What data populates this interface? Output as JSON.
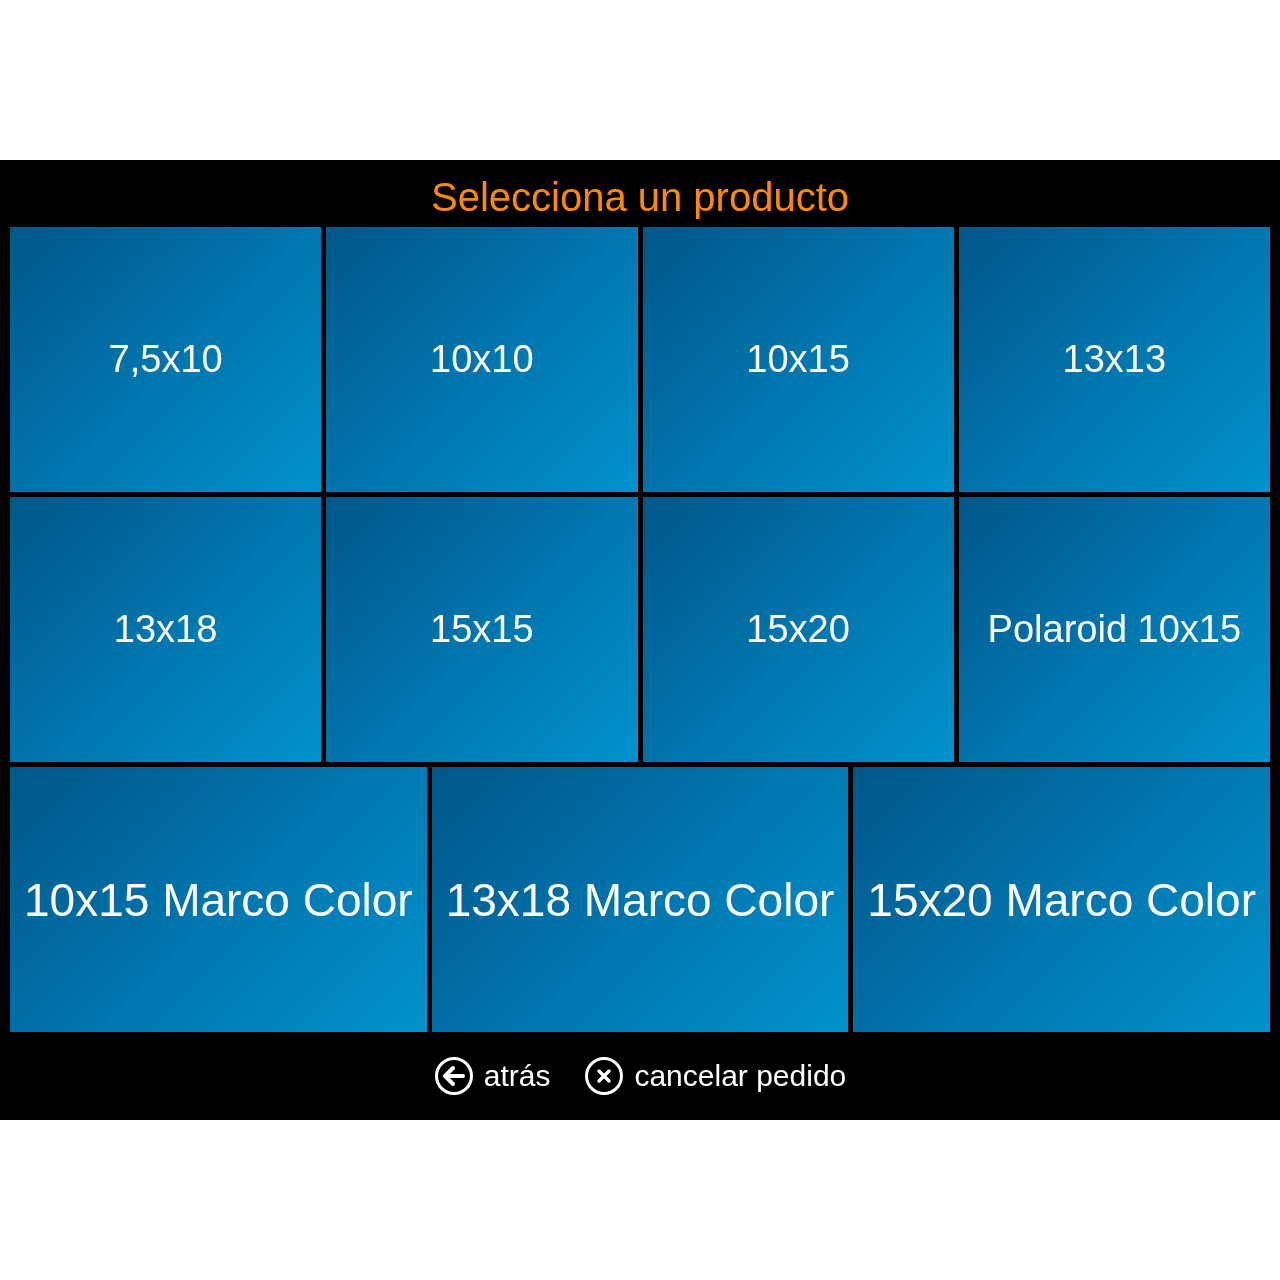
{
  "title": "Selecciona un producto",
  "rows": [
    {
      "kind": "small",
      "tiles": [
        {
          "label": "7,5x10"
        },
        {
          "label": "10x10"
        },
        {
          "label": "10x15"
        },
        {
          "label": "13x13"
        }
      ]
    },
    {
      "kind": "small",
      "tiles": [
        {
          "label": "13x18"
        },
        {
          "label": "15x15"
        },
        {
          "label": "15x20"
        },
        {
          "label": "Polaroid 10x15"
        }
      ]
    },
    {
      "kind": "large",
      "tiles": [
        {
          "label": "10x15 Marco Color"
        },
        {
          "label": "13x18 Marco Color"
        },
        {
          "label": "15x20 Marco Color"
        }
      ]
    }
  ],
  "buttons": [
    {
      "kind": "back",
      "label": "atrás"
    },
    {
      "kind": "cancel",
      "label": "cancelar pedido"
    }
  ]
}
